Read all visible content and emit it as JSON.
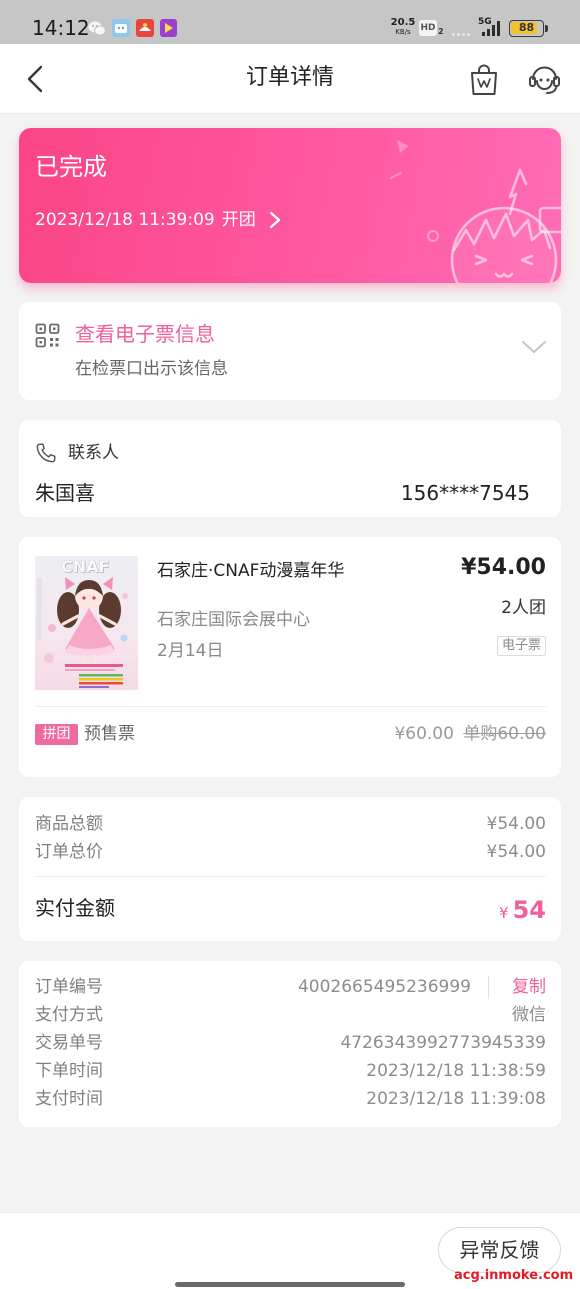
{
  "colors": {
    "accent": "#f0609b",
    "status_card_start": "#fa4585",
    "status_card_end": "#ff6cb6",
    "tag_bg": "#f06a9f",
    "page_bg": "#f3f3f3",
    "status_bar_bg": "#c6c6c6",
    "battery_fill": "#f2c230",
    "watermark": "#e31b23"
  },
  "status_bar": {
    "time": "14:12",
    "app_icons": [
      "wechat-icon",
      "app-icon-blue",
      "app-icon-red",
      "app-icon-purple"
    ],
    "net_speed": "20.5",
    "net_speed_unit": "KB/s",
    "hd": "HD",
    "hd_sim": "2",
    "network": "5G",
    "battery": "88"
  },
  "header": {
    "title": "订单详情",
    "icons": [
      "back-arrow-icon",
      "shopping-bag-icon",
      "customer-service-icon"
    ]
  },
  "status_card": {
    "status": "已完成",
    "time": "2023/12/18 11:39:09",
    "action": "开团",
    "icon": "chevron-right-icon"
  },
  "ticket": {
    "icon": "qr-code-icon",
    "title": "查看电子票信息",
    "hint": "在检票口出示该信息"
  },
  "contact": {
    "icon": "phone-icon",
    "label": "联系人",
    "name": "朱国喜",
    "phone": "156****7545"
  },
  "product": {
    "poster_text": "CNAF",
    "title": "石家庄·CNAF动漫嘉年华",
    "price": "¥54.00",
    "group_size": "2人团",
    "venue": "石家庄国际会展中心",
    "date": "2月14日",
    "ticket_badge": "电子票",
    "tag": "拼团",
    "ticket_name": "预售票",
    "ticket_price": "¥60.00",
    "single_price": "单购60.00"
  },
  "summary": {
    "rows": [
      {
        "label": "商品总额",
        "value": "¥54.00"
      },
      {
        "label": "订单总价",
        "value": "¥54.00"
      }
    ],
    "paid_label": "实付金额",
    "paid_currency": "¥",
    "paid_amount": "54"
  },
  "order_info": {
    "rows": [
      {
        "label": "订单编号",
        "value": "4002665495236999"
      },
      {
        "label": "支付方式",
        "value": "微信"
      },
      {
        "label": "交易单号",
        "value": "4726343992773945339"
      },
      {
        "label": "下单时间",
        "value": "2023/12/18 11:38:59"
      },
      {
        "label": "支付时间",
        "value": "2023/12/18 11:39:08"
      }
    ],
    "copy_label": "复制"
  },
  "footer": {
    "feedback_button": "异常反馈"
  },
  "watermark": "acg.inmoke.com"
}
